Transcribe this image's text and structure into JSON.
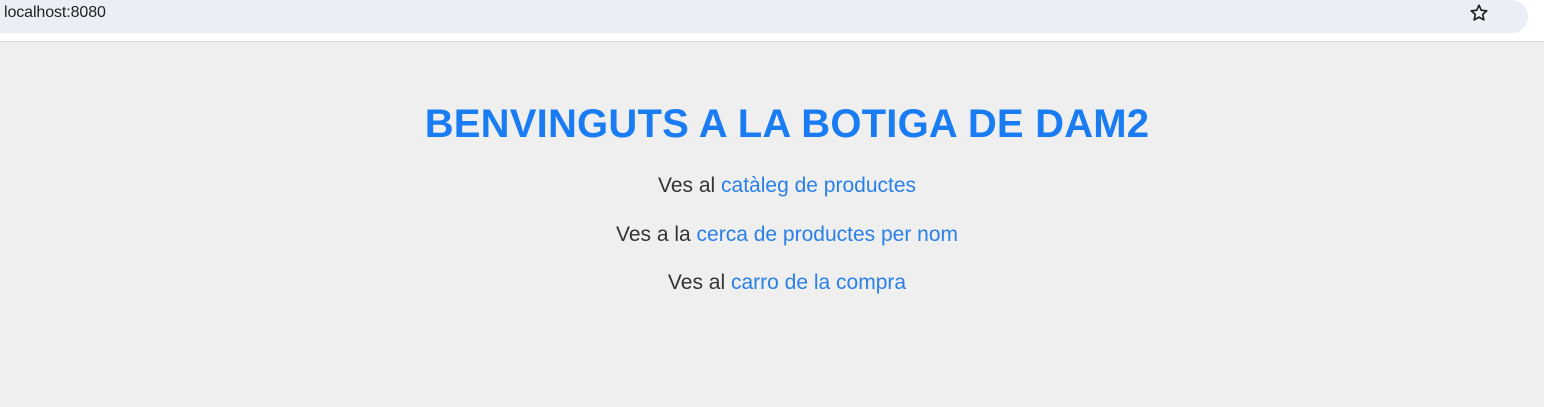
{
  "browser": {
    "url": "localhost:8080",
    "bookmark_icon": "star-icon"
  },
  "main": {
    "title": "BENVINGUTS A LA BOTIGA DE DAM2",
    "links": [
      {
        "prefix": "Ves al",
        "link_text": "catàleg de productes"
      },
      {
        "prefix": "Ves a la",
        "link_text": "cerca de productes per nom"
      },
      {
        "prefix": "Ves al",
        "link_text": "carro de la compra"
      }
    ]
  },
  "colors": {
    "title": "#1a7cf3",
    "link": "#2a80e8",
    "text": "#333333",
    "background": "#efefef"
  }
}
